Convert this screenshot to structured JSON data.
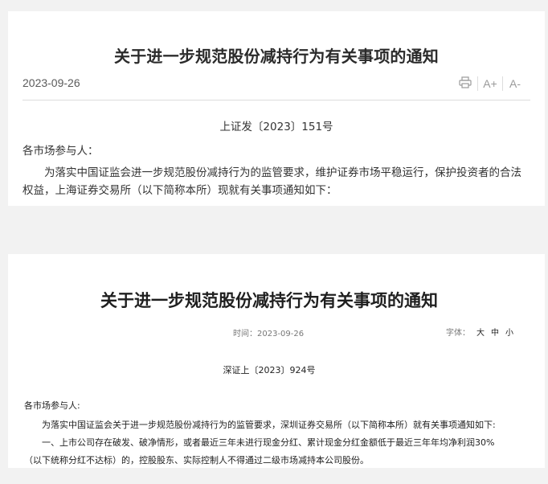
{
  "notice1": {
    "title": "关于进一步规范股份减持行为有关事项的通知",
    "date": "2023-09-26",
    "tools": {
      "print_icon": "print-icon",
      "increase_font": "A+",
      "decrease_font": "A-"
    },
    "doc_number": "上证发〔2023〕151号",
    "salutation": "各市场参与人：",
    "paragraph": "为落实中国证监会进一步规范股份减持行为的监管要求，维护证券市场平稳运行，保护投资者的合法权益，上海证券交易所（以下简称本所）现就有关事项通知如下："
  },
  "notice2": {
    "title": "关于进一步规范股份减持行为有关事项的通知",
    "time_label": "时间：",
    "time_value": "2023-09-26",
    "font_size_label": "字体：",
    "font_sizes": [
      "大",
      "中",
      "小"
    ],
    "doc_number": "深证上〔2023〕924号",
    "salutation": "各市场参与人:",
    "paragraph1": "为落实中国证监会关于进一步规范股份减持行为的监管要求，深圳证券交易所（以下简称本所）就有关事项通知如下:",
    "paragraph2": "一、上市公司存在破发、破净情形，或者最近三年未进行现金分红、累计现金分红金额低于最近三年年均净利润30%（以下统称分红不达标）的，控股股东、实际控制人不得通过二级市场减持本公司股份。"
  }
}
